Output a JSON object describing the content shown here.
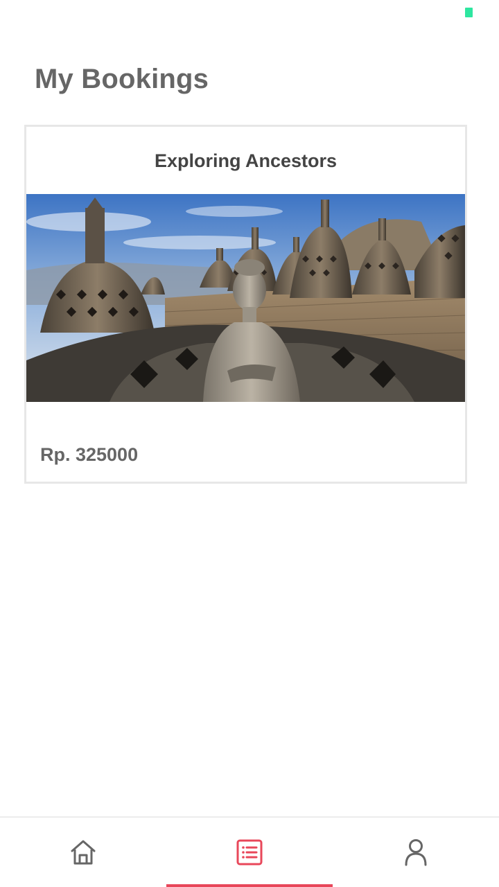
{
  "page": {
    "title": "My Bookings"
  },
  "bookings": [
    {
      "title": "Exploring Ancestors",
      "price": "Rp. 325000"
    }
  ],
  "bottom_nav": {
    "items": [
      {
        "icon": "home-icon",
        "active": false
      },
      {
        "icon": "list-icon",
        "active": true
      },
      {
        "icon": "user-icon",
        "active": false
      }
    ],
    "active_color": "#e8475a",
    "inactive_color": "#666666"
  },
  "status": {
    "indicator_color": "#2ee6a0"
  }
}
